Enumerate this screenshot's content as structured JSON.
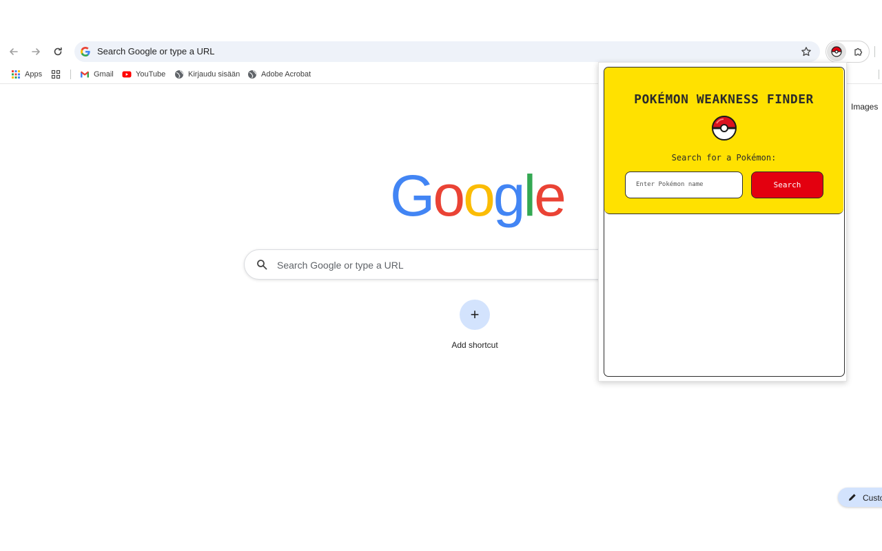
{
  "browser": {
    "omnibox_text": "Search Google or type a URL"
  },
  "bookmarks": [
    {
      "label": "Apps"
    },
    {
      "label": "Gmail"
    },
    {
      "label": "YouTube"
    },
    {
      "label": "Kirjaudu sisään"
    },
    {
      "label": "Adobe Acrobat"
    }
  ],
  "ntp": {
    "images_link": "Images",
    "logo_letters": [
      "G",
      "o",
      "o",
      "g",
      "l",
      "e"
    ],
    "logo_colors": [
      "#4285f4",
      "#ea4335",
      "#fbbc05",
      "#4285f4",
      "#34a853",
      "#ea4335"
    ],
    "search_placeholder": "Search Google or type a URL",
    "add_shortcut_icon": "+",
    "add_shortcut_label": "Add shortcut",
    "customize_label": "Custo"
  },
  "extension": {
    "title": "POKÉMON WEAKNESS FINDER",
    "subtitle": "Search for a Pokémon:",
    "input_placeholder": "Enter Pokémon name",
    "search_button": "Search",
    "colors": {
      "header_bg": "#ffe100",
      "button_bg": "#e3000f",
      "border": "#2b2b2b"
    }
  }
}
